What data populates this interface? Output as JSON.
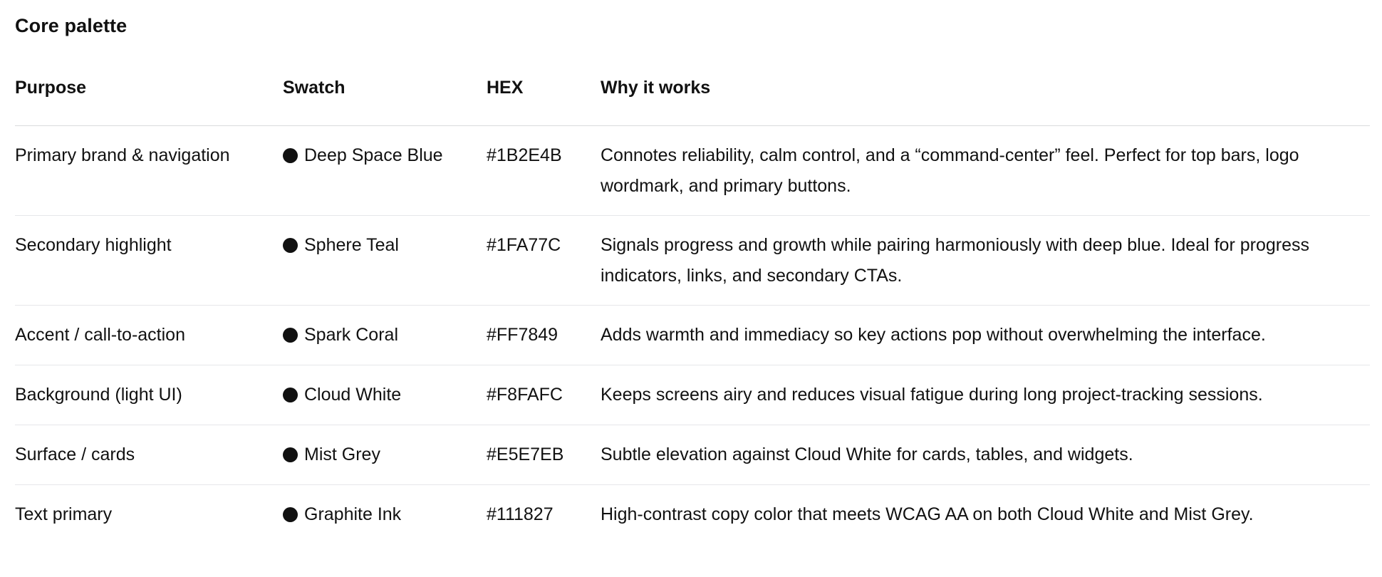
{
  "section": {
    "title": "Core palette"
  },
  "table": {
    "headers": {
      "purpose": "Purpose",
      "swatch": "Swatch",
      "hex": "HEX",
      "why": "Why it works"
    },
    "dot_icon": "black-circle-icon",
    "rows": [
      {
        "purpose": "Primary brand & navigation",
        "swatch": "Deep Space Blue",
        "hex": "#1B2E4B",
        "why": "Connotes reliability, calm control, and a “command-center” feel. Perfect for top bars, logo wordmark, and primary buttons."
      },
      {
        "purpose": "Secondary highlight",
        "swatch": "Sphere Teal",
        "hex": "#1FA77C",
        "why": "Signals progress and growth while pairing harmoniously with deep blue. Ideal for progress indicators, links, and secondary CTAs."
      },
      {
        "purpose": "Accent / call-to-action",
        "swatch": "Spark Coral",
        "hex": "#FF7849",
        "why": "Adds warmth and immediacy so key actions pop without overwhelming the interface."
      },
      {
        "purpose": "Background (light UI)",
        "swatch": "Cloud White",
        "hex": "#F8FAFC",
        "why": "Keeps screens airy and reduces visual fatigue during long project-tracking sessions."
      },
      {
        "purpose": "Surface / cards",
        "swatch": "Mist Grey",
        "hex": "#E5E7EB",
        "why": "Subtle elevation against Cloud White for cards, tables, and widgets."
      },
      {
        "purpose": "Text primary",
        "swatch": "Graphite Ink",
        "hex": "#111827",
        "why": "High-contrast copy color that meets WCAG AA on both Cloud White and Mist Grey."
      }
    ]
  }
}
